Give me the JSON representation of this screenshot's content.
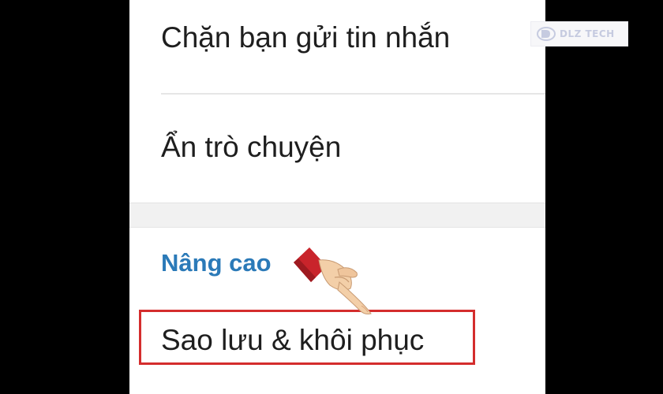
{
  "menu": {
    "block_messages": "Chặn bạn gửi tin nhắn",
    "hide_chat": "Ẩn trò chuyện",
    "section_advanced": "Nâng cao",
    "backup_restore": "Sao lưu & khôi phục"
  },
  "watermark": {
    "text": "DLZ TECH",
    "icon": "dlz-logo-icon"
  },
  "overlay": {
    "pointer_icon": "pointing-hand-icon",
    "highlight_color": "#d42d2d"
  },
  "colors": {
    "accent": "#2b7ab8",
    "text": "#1e1e1e",
    "background": "#000000",
    "panel": "#ffffff"
  }
}
